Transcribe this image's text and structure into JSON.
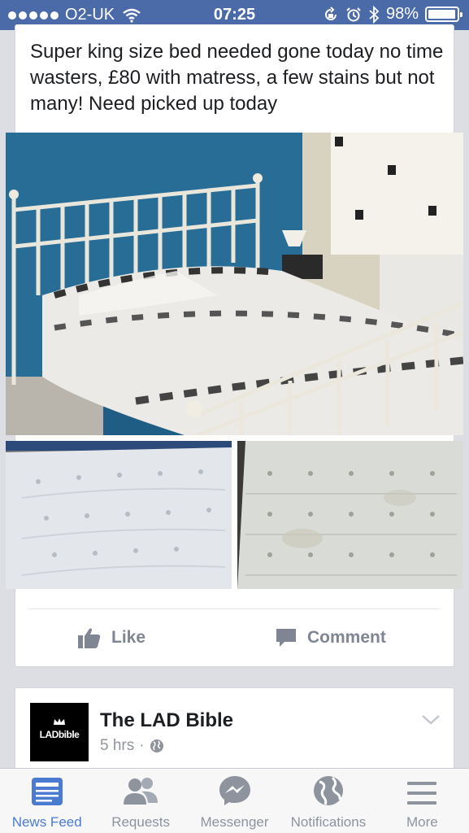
{
  "status_bar": {
    "carrier": "O2-UK",
    "time": "07:25",
    "battery": "98%",
    "battery_level": 0.98
  },
  "post": {
    "text": "Super king size bed needed gone today no time wasters, £80 with matress, a few stains but not many! Need picked up today",
    "photos": [
      "bed-photo",
      "mattress-photo-1",
      "mattress-photo-2"
    ],
    "actions": {
      "like_label": "Like",
      "comment_label": "Comment"
    }
  },
  "next_post": {
    "page_name": "The LAD Bible",
    "logo_text": "LADbible",
    "time_ago": "5 hrs",
    "separator": "·"
  },
  "tab_bar": {
    "tabs": [
      {
        "label": "News Feed",
        "icon": "news-feed-icon",
        "active": true
      },
      {
        "label": "Requests",
        "icon": "friend-requests-icon",
        "active": false
      },
      {
        "label": "Messenger",
        "icon": "messenger-icon",
        "active": false
      },
      {
        "label": "Notifications",
        "icon": "globe-icon",
        "active": false
      },
      {
        "label": "More",
        "icon": "menu-icon",
        "active": false
      }
    ]
  },
  "colors": {
    "status_bar": "#4a6aa8",
    "active_tab": "#4a7bd0",
    "inactive": "#8d949e"
  }
}
